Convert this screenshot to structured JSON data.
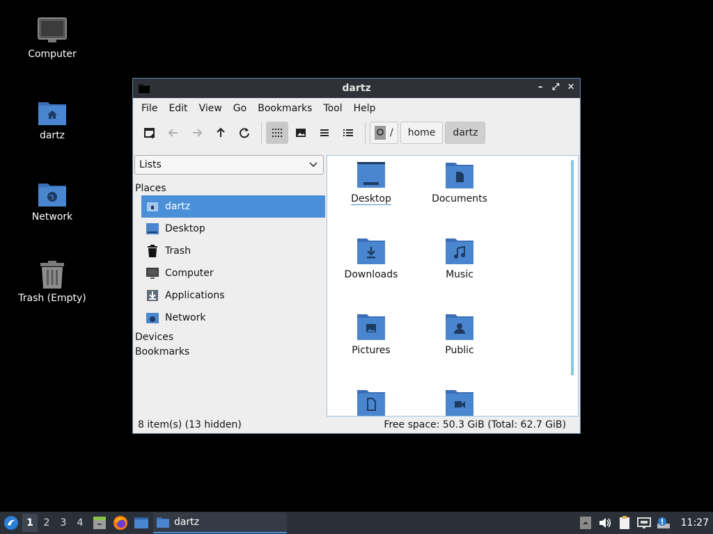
{
  "desktop": {
    "icons": [
      {
        "label": "Computer",
        "icon": "computer-icon"
      },
      {
        "label": "dartz",
        "icon": "home-folder-icon"
      },
      {
        "label": "Network",
        "icon": "network-folder-icon"
      },
      {
        "label": "Trash (Empty)",
        "icon": "trash-icon"
      }
    ]
  },
  "window": {
    "title": "dartz",
    "menu": [
      "File",
      "Edit",
      "View",
      "Go",
      "Bookmarks",
      "Tool",
      "Help"
    ],
    "breadcrumb": {
      "root": "/",
      "items": [
        "home",
        "dartz"
      ]
    },
    "side": {
      "selector": "Lists",
      "places_header": "Places",
      "places": [
        "dartz",
        "Desktop",
        "Trash",
        "Computer",
        "Applications",
        "Network"
      ],
      "devices_header": "Devices",
      "bookmarks_header": "Bookmarks"
    },
    "files": [
      "Desktop",
      "Documents",
      "Downloads",
      "Music",
      "Pictures",
      "Public",
      "",
      ""
    ],
    "status": {
      "items": "8 item(s) (13 hidden)",
      "space": "Free space: 50.3 GiB (Total: 62.7 GiB)"
    }
  },
  "taskbar": {
    "workspaces": [
      "1",
      "2",
      "3",
      "4"
    ],
    "active_workspace": "1",
    "task": "dartz",
    "clock": "11:27"
  },
  "colors": {
    "accent": "#4a90d9",
    "folder": "#4a86cf",
    "titlebar": "#2e3238",
    "taskbar": "#2b3038"
  }
}
